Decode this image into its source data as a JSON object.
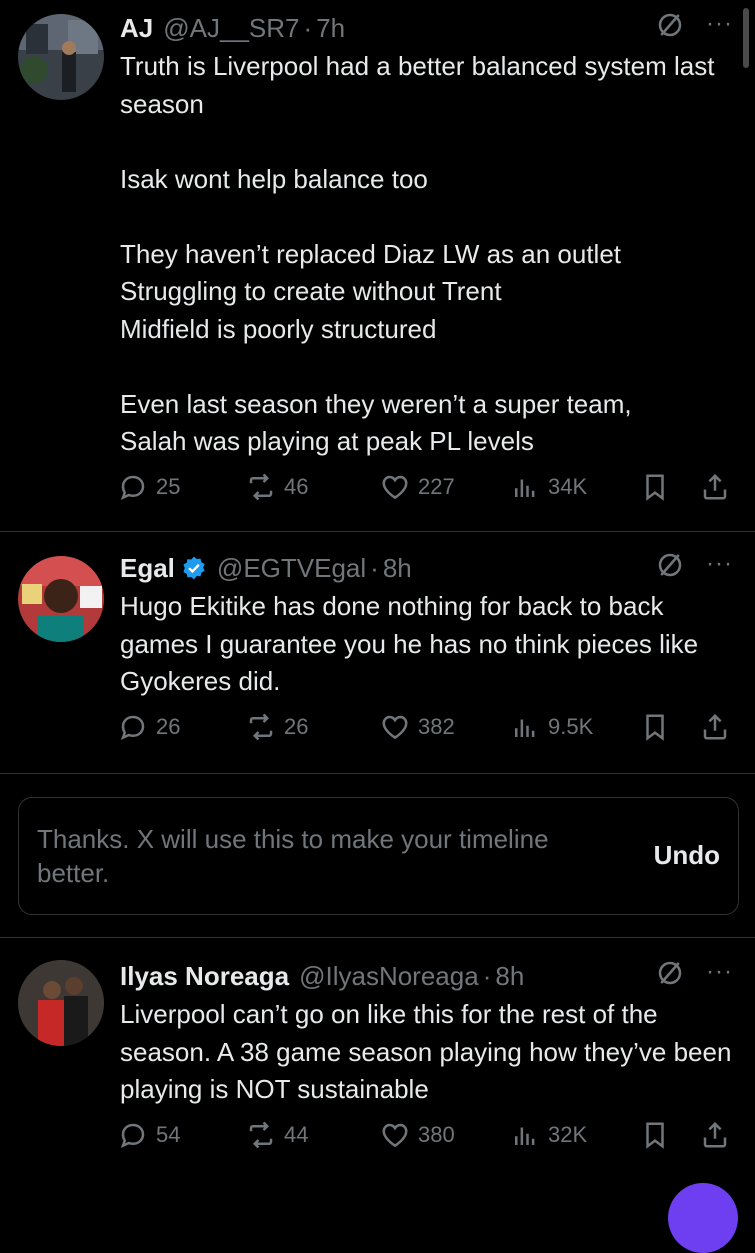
{
  "tweets": [
    {
      "name": "AJ",
      "handle": "@AJ__SR7",
      "time": "7h",
      "verified": false,
      "text": "Truth is Liverpool had a better balanced system last season\n\nIsak wont help balance too\n\nThey haven’t replaced Diaz LW as an outlet\nStruggling to create without Trent\nMidfield is poorly structured\n\nEven last season they weren’t a super team,\nSalah was playing at peak PL levels",
      "replies": "25",
      "reposts": "46",
      "likes": "227",
      "views": "34K"
    },
    {
      "name": "Egal",
      "handle": "@EGTVEgal",
      "time": "8h",
      "verified": true,
      "text": "Hugo Ekitike has done nothing for back to back games I guarantee you he has no think pieces like Gyokeres did.",
      "replies": "26",
      "reposts": "26",
      "likes": "382",
      "views": "9.5K"
    },
    {
      "name": "Ilyas Noreaga",
      "handle": "@IlyasNoreaga",
      "time": "8h",
      "verified": false,
      "text": "Liverpool can’t go on like this for the rest of the season. A 38 game season playing how they’ve been playing is NOT sustainable",
      "replies": "54",
      "reposts": "44",
      "likes": "380",
      "views": "32K"
    }
  ],
  "notice": {
    "text": "Thanks. X will use this to make your timeline better.",
    "undo": "Undo"
  },
  "separator_dot": "·",
  "more_label": "···",
  "colors": {
    "background": "#000000",
    "text": "#e7e9ea",
    "muted": "#71767b",
    "border": "#2f3336",
    "verified": "#1d9bf0",
    "fab": "#6d3ff0"
  },
  "icons": [
    "reply-icon",
    "repost-icon",
    "like-icon",
    "views-icon",
    "bookmark-icon",
    "share-icon",
    "grok-icon",
    "more-icon",
    "verified-icon"
  ]
}
